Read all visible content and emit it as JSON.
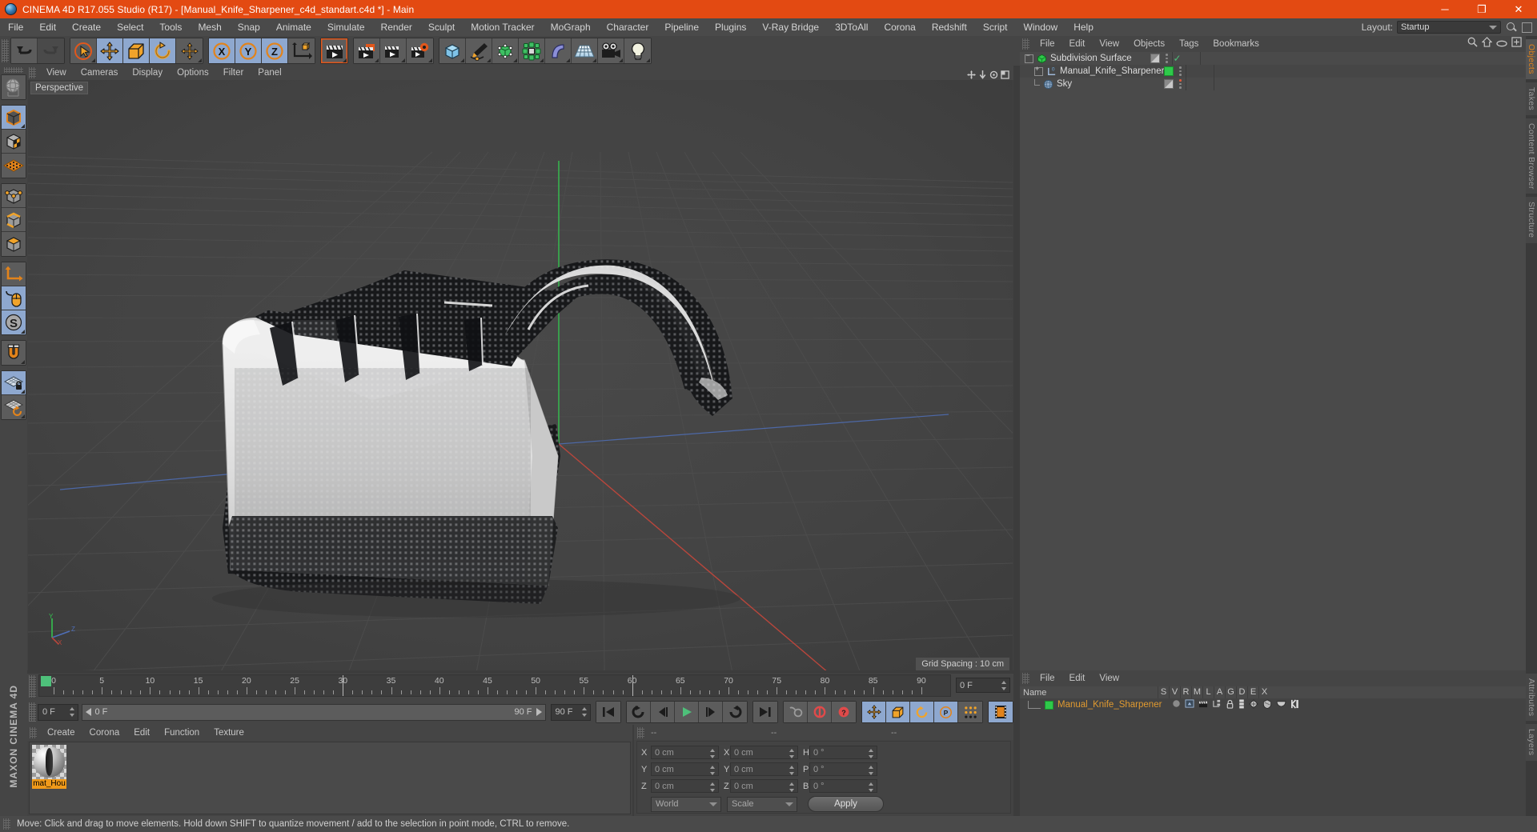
{
  "titlebar": {
    "app_icon": "c4d-logo-icon",
    "title": "CINEMA 4D R17.055 Studio (R17) - [Manual_Knife_Sharpener_c4d_standart.c4d *] - Main",
    "minimize": "─",
    "maximize": "❐",
    "close": "✕",
    "bg_color": "#e34a12"
  },
  "menubar": {
    "items": [
      {
        "label": "File"
      },
      {
        "label": "Edit"
      },
      {
        "label": "Create"
      },
      {
        "label": "Select"
      },
      {
        "label": "Tools"
      },
      {
        "label": "Mesh"
      },
      {
        "label": "Snap"
      },
      {
        "label": "Animate"
      },
      {
        "label": "Simulate"
      },
      {
        "label": "Render"
      },
      {
        "label": "Sculpt"
      },
      {
        "label": "Motion Tracker"
      },
      {
        "label": "MoGraph"
      },
      {
        "label": "Character"
      },
      {
        "label": "Pipeline"
      },
      {
        "label": "Plugins"
      },
      {
        "label": "V-Ray Bridge"
      },
      {
        "label": "3DToAll"
      },
      {
        "label": "Corona"
      },
      {
        "label": "Redshift"
      },
      {
        "label": "Script"
      },
      {
        "label": "Window"
      },
      {
        "label": "Help"
      }
    ],
    "layout_label": "Layout:",
    "layout_value": "Startup"
  },
  "toolbar": {
    "groups": [
      {
        "buttons": [
          {
            "name": "undo-button",
            "icon": "undo-arrow-icon",
            "state": "normal"
          },
          {
            "name": "redo-button",
            "icon": "redo-arrow-icon",
            "state": "disabled"
          }
        ]
      },
      {
        "buttons": [
          {
            "name": "live-selection-button",
            "icon": "cursor-circle-icon",
            "state": "normal"
          },
          {
            "name": "move-tool-button",
            "icon": "move-cross-icon",
            "state": "active"
          },
          {
            "name": "scale-tool-button",
            "icon": "scale-square-icon",
            "state": "active"
          },
          {
            "name": "rotate-tool-button",
            "icon": "rotate-arc-icon",
            "state": "active"
          },
          {
            "name": "dynamic-place-button",
            "icon": "move-cross-icon",
            "state": "normal"
          }
        ]
      },
      {
        "buttons": [
          {
            "name": "x-axis-lock-button",
            "icon": "axis-x-icon",
            "state": "active"
          },
          {
            "name": "y-axis-lock-button",
            "icon": "axis-y-icon",
            "state": "active"
          },
          {
            "name": "z-axis-lock-button",
            "icon": "axis-z-icon",
            "state": "active"
          },
          {
            "name": "world-object-coord-button",
            "icon": "world-axis-cube-icon",
            "state": "normal"
          }
        ]
      },
      {
        "buttons": [
          {
            "name": "render-view-button",
            "icon": "render-clapper-icon",
            "state": "selected"
          }
        ]
      },
      {
        "buttons": [
          {
            "name": "render-region-button",
            "icon": "render-region-clapper-icon",
            "state": "normal"
          },
          {
            "name": "render-to-pv-button",
            "icon": "render-pv-clapper-icon",
            "state": "normal"
          },
          {
            "name": "render-settings-button",
            "icon": "render-settings-gear-icon",
            "state": "normal"
          }
        ]
      },
      {
        "buttons": [
          {
            "name": "add-cube-button",
            "icon": "cube-blue-icon",
            "state": "normal"
          },
          {
            "name": "add-spline-button",
            "icon": "pen-spline-icon",
            "state": "normal"
          },
          {
            "name": "add-nurbs-button",
            "icon": "green-nurbs-cube-icon",
            "state": "normal"
          },
          {
            "name": "add-array-button",
            "icon": "array-green-icon",
            "state": "normal"
          },
          {
            "name": "add-deformer-button",
            "icon": "bend-deformer-icon",
            "state": "normal"
          },
          {
            "name": "add-environment-button",
            "icon": "floor-grid-icon",
            "state": "normal"
          },
          {
            "name": "add-camera-button",
            "icon": "camera-icon",
            "state": "normal"
          },
          {
            "name": "add-light-button",
            "icon": "light-bulb-icon",
            "state": "normal"
          }
        ]
      }
    ]
  },
  "lefttools": {
    "buttons": [
      {
        "name": "make-editable-globe-button",
        "icon": "globe-wireframe-icon",
        "state": "normal",
        "group": 0
      },
      {
        "name": "model-mode-button",
        "icon": "cube-orange-outline-icon",
        "state": "active",
        "group": 1
      },
      {
        "name": "texture-mode-button",
        "icon": "checker-cube-icon",
        "state": "normal",
        "group": 1
      },
      {
        "name": "uv-mesh-mode-button",
        "icon": "orange-grid-mesh-icon",
        "state": "normal",
        "group": 1
      },
      {
        "name": "point-mode-button",
        "icon": "point-cube-icon",
        "state": "normal",
        "group": 2
      },
      {
        "name": "edge-mode-button",
        "icon": "edge-cube-icon",
        "state": "normal",
        "group": 2
      },
      {
        "name": "polygon-mode-button",
        "icon": "polygon-cube-icon",
        "state": "normal",
        "group": 2
      },
      {
        "name": "axis-mode-button",
        "icon": "axis-corner-icon",
        "state": "normal",
        "group": 3
      },
      {
        "name": "viewport-solo-button",
        "icon": "mouse-icon",
        "state": "active",
        "group": 3
      },
      {
        "name": "soft-selection-button",
        "icon": "s-sphere-icon",
        "state": "active",
        "group": 3
      },
      {
        "name": "magnet-button",
        "icon": "magnet-icon",
        "state": "normal",
        "group": 4
      },
      {
        "name": "workplane-lock-button",
        "icon": "grid-lock-icon",
        "state": "active",
        "group": 5
      },
      {
        "name": "workplane-rotate-button",
        "icon": "grid-rotate-icon",
        "state": "normal",
        "group": 5
      }
    ],
    "brand": "MAXON CINEMA 4D"
  },
  "viewport": {
    "menu": [
      {
        "label": "View"
      },
      {
        "label": "Cameras"
      },
      {
        "label": "Display"
      },
      {
        "label": "Options"
      },
      {
        "label": "Filter"
      },
      {
        "label": "Panel"
      }
    ],
    "view_label": "Perspective",
    "grid_spacing": "Grid Spacing : 10 cm",
    "axis_labels": {
      "x": "X",
      "y": "Y",
      "z": "Z"
    },
    "bg_color": "#3f3f3f"
  },
  "object_manager": {
    "menu": [
      {
        "label": "File"
      },
      {
        "label": "Edit"
      },
      {
        "label": "View"
      },
      {
        "label": "Objects"
      },
      {
        "label": "Tags"
      },
      {
        "label": "Bookmarks"
      }
    ],
    "tools": [
      "search-icon",
      "home-icon",
      "ellipse-icon",
      "new-layer-icon"
    ],
    "rows": [
      {
        "name": "Subdivision Surface",
        "icon": "subdivision-surface-icon",
        "twirl": "minus",
        "indent": 0,
        "swatch": "half",
        "enabled_check": true
      },
      {
        "name": "Manual_Knife_Sharpener",
        "icon": "null-object-icon",
        "twirl": "plus",
        "indent": 1,
        "swatch": "green",
        "enabled_check": false
      },
      {
        "name": "Sky",
        "icon": "sky-sphere-icon",
        "twirl": "none",
        "indent": 1,
        "swatch": "half",
        "enabled_check": false
      }
    ]
  },
  "right_tabs": {
    "top": [
      {
        "label": "Objects",
        "active": true
      },
      {
        "label": "Takes",
        "active": false
      },
      {
        "label": "Content Browser",
        "active": false
      },
      {
        "label": "Structure",
        "active": false
      }
    ],
    "bottom": [
      {
        "label": "Attributes",
        "active": false
      },
      {
        "label": "Layers",
        "active": false
      }
    ]
  },
  "timeline": {
    "start_frame": "0 F",
    "end_frame": "90 F",
    "current_frame": "0 F",
    "ticks": [
      0,
      5,
      10,
      15,
      20,
      25,
      30,
      35,
      40,
      45,
      50,
      55,
      60,
      65,
      70,
      75,
      80,
      85,
      90
    ],
    "min": 0,
    "max": 92,
    "playhead_positions": [
      30,
      60
    ]
  },
  "playback": {
    "field_start": "0 F",
    "field_range_start": "0 F",
    "field_range_end": "90 F",
    "field_end": "90 F",
    "buttons": [
      {
        "name": "go-to-start-button",
        "icon": "skip-start-icon"
      },
      {
        "name": "go-to-prev-key-button",
        "icon": "prev-key-icon"
      },
      {
        "name": "step-back-button",
        "icon": "step-back-icon"
      },
      {
        "name": "play-button",
        "icon": "play-icon"
      },
      {
        "name": "step-forward-button",
        "icon": "step-forward-icon"
      },
      {
        "name": "go-to-next-key-button",
        "icon": "next-key-icon"
      },
      {
        "name": "go-to-end-button",
        "icon": "skip-end-icon"
      },
      {
        "name": "autokey-toggle-button",
        "icon": "key-icon"
      },
      {
        "name": "record-active-objects-button",
        "icon": "record-circle-icon"
      },
      {
        "name": "record-question-button",
        "icon": "record-question-icon"
      },
      {
        "name": "position-key-button",
        "icon": "move-cross-icon"
      },
      {
        "name": "scale-key-button",
        "icon": "scale-square-icon"
      },
      {
        "name": "rotation-key-button",
        "icon": "rotate-arc-icon"
      },
      {
        "name": "param-key-button",
        "icon": "p-circle-icon"
      },
      {
        "name": "pla-key-button",
        "icon": "point-grid-icon"
      },
      {
        "name": "timeline-button",
        "icon": "film-strip-icon"
      }
    ]
  },
  "material_manager": {
    "menu": [
      {
        "label": "Create"
      },
      {
        "label": "Corona"
      },
      {
        "label": "Edit"
      },
      {
        "label": "Function"
      },
      {
        "label": "Texture"
      }
    ],
    "materials": [
      {
        "name": "mat_Hou",
        "preview": "glossy-sphere-preview",
        "selected": true
      }
    ]
  },
  "coordinates": {
    "header": {
      "position": "--",
      "size": "--",
      "rotation": "--"
    },
    "rows": [
      {
        "axis": "X",
        "position": "0 cm",
        "size": "0 cm",
        "rot_label": "H",
        "rotation": "0 °"
      },
      {
        "axis": "Y",
        "position": "0 cm",
        "size": "0 cm",
        "rot_label": "P",
        "rotation": "0 °"
      },
      {
        "axis": "Z",
        "position": "0 cm",
        "size": "0 cm",
        "rot_label": "B",
        "rotation": "0 °"
      }
    ],
    "coord_system": "World",
    "transform_mode": "Scale",
    "apply_label": "Apply"
  },
  "attributes": {
    "menu": [
      {
        "label": "File"
      },
      {
        "label": "Edit"
      },
      {
        "label": "View"
      }
    ],
    "header": {
      "name": "Name",
      "columns": [
        "S",
        "V",
        "R",
        "M",
        "L",
        "A",
        "G",
        "D",
        "E",
        "X"
      ]
    },
    "row": {
      "name": "Manual_Knife_Sharpener",
      "tags": [
        "solo-dot-icon",
        "display-tag-icon",
        "render-tag-icon",
        "compositing-tag-icon",
        "lock-icon",
        "layer-icon",
        "phong-tag-icon",
        "protect-tag-icon",
        "deform-tag-icon",
        "xref-tag-icon"
      ]
    }
  },
  "statusbar": {
    "message": "Move: Click and drag to move elements. Hold down SHIFT to quantize movement / add to the selection in point mode, CTRL to remove."
  }
}
